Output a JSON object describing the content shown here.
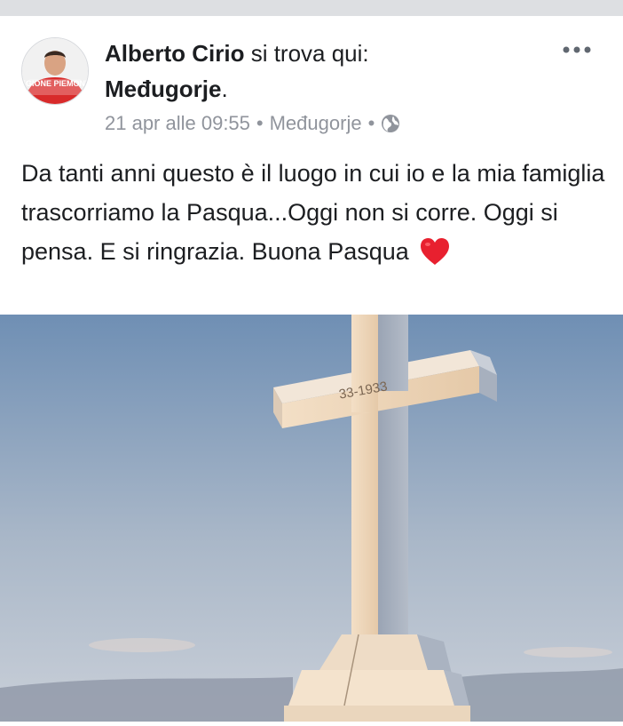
{
  "post": {
    "author": "Alberto Cirio",
    "verb": "si trova qui:",
    "place": "Međugorje",
    "place_suffix": ".",
    "timestamp": "21 apr alle 09:55",
    "separator": "•",
    "location": "Međugorje",
    "privacy_icon": "globe-icon",
    "more_icon": "more-options-icon",
    "text": "Da tanti anni questo è il luogo in cui io e la mia famiglia trascorriamo la Pasqua...Oggi non si corre. Oggi si pensa. E si ringrazia. Buona Pasqua",
    "emoji": "red-heart",
    "avatar_text": "REGIONE PIEMONTE"
  },
  "photo": {
    "inscription": "33-1933"
  },
  "colors": {
    "text": "#1c1e21",
    "meta": "#90949c",
    "heart": "#e8202f",
    "sky_top": "#6f8fb4",
    "sky_bottom": "#c4cedb"
  }
}
